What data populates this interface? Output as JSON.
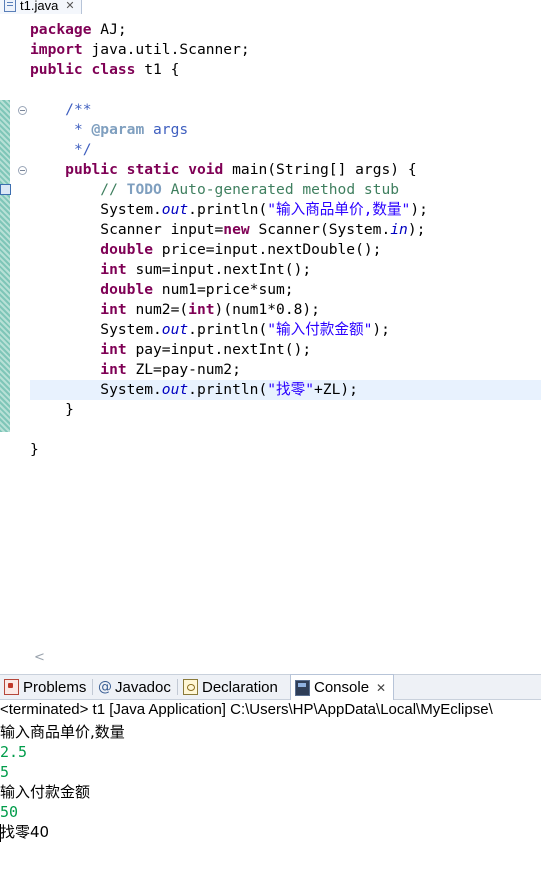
{
  "editor": {
    "tab_title": "t1.java",
    "close_glyph": "✕",
    "code_lines": [
      [
        {
          "c": "kw",
          "t": "package"
        },
        {
          "t": " AJ;"
        }
      ],
      [
        {
          "c": "kw",
          "t": "import"
        },
        {
          "t": " java.util.Scanner;"
        }
      ],
      [
        {
          "c": "kw",
          "t": "public"
        },
        {
          "t": " "
        },
        {
          "c": "kw",
          "t": "class"
        },
        {
          "t": " t1 {"
        }
      ],
      [],
      [
        {
          "t": "    "
        },
        {
          "c": "cm",
          "t": "/**"
        }
      ],
      [
        {
          "t": "     "
        },
        {
          "c": "cm",
          "t": "* "
        },
        {
          "c": "tag",
          "t": "@param"
        },
        {
          "c": "cm",
          "t": " args"
        }
      ],
      [
        {
          "t": "     "
        },
        {
          "c": "cm",
          "t": "*/"
        }
      ],
      [
        {
          "t": "    "
        },
        {
          "c": "kw",
          "t": "public"
        },
        {
          "t": " "
        },
        {
          "c": "kw",
          "t": "static"
        },
        {
          "t": " "
        },
        {
          "c": "kw",
          "t": "void"
        },
        {
          "t": " main(String[] args) {"
        }
      ],
      [
        {
          "t": "        "
        },
        {
          "c": "lc",
          "t": "// "
        },
        {
          "c": "todo",
          "t": "TODO"
        },
        {
          "c": "lc",
          "t": " Auto-generated method stub"
        }
      ],
      [
        {
          "t": "        System."
        },
        {
          "c": "fld",
          "t": "out"
        },
        {
          "t": ".println("
        },
        {
          "c": "st",
          "t": "\"输入商品单价,数量\""
        },
        {
          "t": ");"
        }
      ],
      [
        {
          "t": "        Scanner input="
        },
        {
          "c": "kw",
          "t": "new"
        },
        {
          "t": " Scanner(System."
        },
        {
          "c": "fld",
          "t": "in"
        },
        {
          "t": ");"
        }
      ],
      [
        {
          "t": "        "
        },
        {
          "c": "kw",
          "t": "double"
        },
        {
          "t": " price=input.nextDouble();"
        }
      ],
      [
        {
          "t": "        "
        },
        {
          "c": "kw",
          "t": "int"
        },
        {
          "t": " sum=input.nextInt();"
        }
      ],
      [
        {
          "t": "        "
        },
        {
          "c": "kw",
          "t": "double"
        },
        {
          "t": " num1=price*sum;"
        }
      ],
      [
        {
          "t": "        "
        },
        {
          "c": "kw",
          "t": "int"
        },
        {
          "t": " num2=("
        },
        {
          "c": "kw",
          "t": "int"
        },
        {
          "t": ")(num1*0.8);"
        }
      ],
      [
        {
          "t": "        System."
        },
        {
          "c": "fld",
          "t": "out"
        },
        {
          "t": ".println("
        },
        {
          "c": "st",
          "t": "\"输入付款金额\""
        },
        {
          "t": ");"
        }
      ],
      [
        {
          "t": "        "
        },
        {
          "c": "kw",
          "t": "int"
        },
        {
          "t": " pay=input.nextInt();"
        }
      ],
      [
        {
          "t": "        "
        },
        {
          "c": "kw",
          "t": "int"
        },
        {
          "t": " ZL=pay-num2;"
        }
      ],
      [
        {
          "t": "        System."
        },
        {
          "c": "fld",
          "t": "out"
        },
        {
          "t": ".println("
        },
        {
          "c": "st",
          "t": "\"找零\""
        },
        {
          "t": "+ZL);"
        }
      ],
      [
        {
          "t": "    }"
        }
      ],
      [],
      [
        {
          "t": "}"
        }
      ]
    ],
    "current_line_index": 18,
    "scroll_left_glyph": "<"
  },
  "views": {
    "tabs": [
      {
        "label": "Problems",
        "icon": "problems-icon",
        "active": false
      },
      {
        "label": "Javadoc",
        "icon": "javadoc-icon",
        "active": false
      },
      {
        "label": "Declaration",
        "icon": "declaration-icon",
        "active": false
      },
      {
        "label": "Console",
        "icon": "console-icon",
        "active": true
      }
    ],
    "javadoc_glyph": "@",
    "close_glyph": "✕"
  },
  "console": {
    "header": "<terminated> t1 [Java Application] C:\\Users\\HP\\AppData\\Local\\MyEclipse\\",
    "lines": [
      {
        "kind": "out",
        "text": "输入商品单价,数量"
      },
      {
        "kind": "in",
        "text": "2.5"
      },
      {
        "kind": "in",
        "text": "5"
      },
      {
        "kind": "out",
        "text": "输入付款金额"
      },
      {
        "kind": "in",
        "text": "50"
      },
      {
        "kind": "out",
        "text": "找零40"
      }
    ]
  },
  "colors": {
    "keyword": "#7f0055",
    "javadoc": "#3f5fbf",
    "comment": "#3f7f5f",
    "string": "#2a00ff",
    "field": "#0000c0",
    "console_input": "#009c4a",
    "current_line": "#e8f2fe"
  }
}
